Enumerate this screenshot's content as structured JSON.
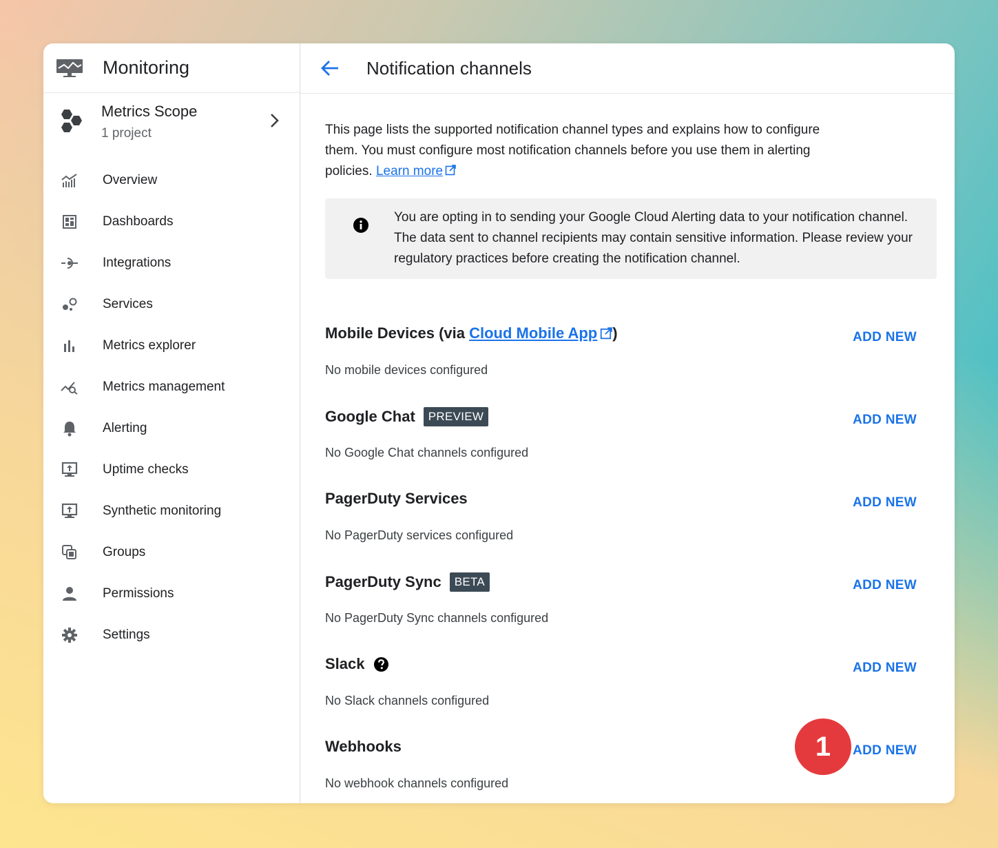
{
  "app": {
    "title": "Monitoring"
  },
  "scope": {
    "name": "Metrics Scope",
    "sub": "1 project"
  },
  "nav": [
    {
      "label": "Overview",
      "icon": "overview-icon"
    },
    {
      "label": "Dashboards",
      "icon": "dashboards-icon"
    },
    {
      "label": "Integrations",
      "icon": "integrations-icon"
    },
    {
      "label": "Services",
      "icon": "services-icon"
    },
    {
      "label": "Metrics explorer",
      "icon": "bar-chart-icon"
    },
    {
      "label": "Metrics management",
      "icon": "metrics-management-icon"
    },
    {
      "label": "Alerting",
      "icon": "bell-icon"
    },
    {
      "label": "Uptime checks",
      "icon": "monitor-icon"
    },
    {
      "label": "Synthetic monitoring",
      "icon": "monitor-icon"
    },
    {
      "label": "Groups",
      "icon": "groups-icon"
    },
    {
      "label": "Permissions",
      "icon": "person-icon"
    },
    {
      "label": "Settings",
      "icon": "gear-icon"
    }
  ],
  "page": {
    "title": "Notification channels",
    "intro": "This page lists the supported notification channel types and explains how to configure them. You must configure most notification channels before you use them in alerting policies.",
    "learn_more": "Learn more",
    "notice": "You are opting in to sending your Google Cloud Alerting data to your notification channel. The data sent to channel recipients may contain sensitive information. Please review your regulatory practices before creating the notification channel."
  },
  "channels": {
    "mobile": {
      "title_prefix": "Mobile Devices (via ",
      "link": "Cloud Mobile App",
      "title_suffix": ")",
      "desc": "No mobile devices configured",
      "action": "ADD NEW"
    },
    "chat": {
      "title": "Google Chat",
      "badge": "PREVIEW",
      "desc": "No Google Chat channels configured",
      "action": "ADD NEW"
    },
    "pagerduty": {
      "title": "PagerDuty Services",
      "desc": "No PagerDuty services configured",
      "action": "ADD NEW"
    },
    "pagerduty_sync": {
      "title": "PagerDuty Sync",
      "badge": "BETA",
      "desc": "No PagerDuty Sync channels configured",
      "action": "ADD NEW"
    },
    "slack": {
      "title": "Slack",
      "desc": "No Slack channels configured",
      "action": "ADD NEW"
    },
    "webhooks": {
      "title": "Webhooks",
      "desc": "No webhook channels configured",
      "action": "ADD NEW"
    }
  },
  "annotation": {
    "step": "1",
    "color": "#e53a3d"
  },
  "colors": {
    "accent": "#1a73e8",
    "badge_bg": "#3c4a55"
  }
}
